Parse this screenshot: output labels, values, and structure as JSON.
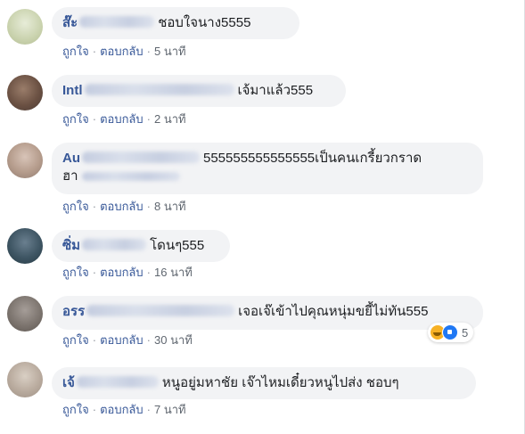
{
  "colors": {
    "bubble_bg": "#f2f3f5",
    "author": "#385898",
    "meta_text": "#606770",
    "haha": "#f7b125",
    "like": "#2078f4"
  },
  "comments": [
    {
      "author": "ส๊ะ",
      "text": "ชอบใจนาง5555",
      "like": "ถูกใจ",
      "reply": "ตอบกลับ",
      "time": "5 นาที"
    },
    {
      "author": "Intl",
      "text": "เจ้มาแล้ว555",
      "like": "ถูกใจ",
      "reply": "ตอบกลับ",
      "time": "2 นาที"
    },
    {
      "author": "Au",
      "text_line1": "555555555555555เป็นคนเกรี้ยวกราด",
      "text_line2": "ฮา",
      "like": "ถูกใจ",
      "reply": "ตอบกลับ",
      "time": "8 นาที"
    },
    {
      "author": "ซิ่ม",
      "text": "โดนๆ555",
      "like": "ถูกใจ",
      "reply": "ตอบกลับ",
      "time": "16 นาที"
    },
    {
      "author": "อรร",
      "text": "เจอเจ๊เข้าไปคุณหนุ่มขยี้ไม่ทัน555",
      "like": "ถูกใจ",
      "reply": "ตอบกลับ",
      "time": "30 นาที",
      "reaction_count": "5",
      "reaction_icons": [
        "haha-icon",
        "like-icon"
      ]
    },
    {
      "author": "เจ้",
      "text": "หนูอยู่มหาชัย เจ๊าไหมเดี๋ยวหนูไปส่ง ชอบๆ",
      "like": "ถูกใจ",
      "reply": "ตอบกลับ",
      "time": "7 นาที"
    }
  ],
  "separator": "·"
}
